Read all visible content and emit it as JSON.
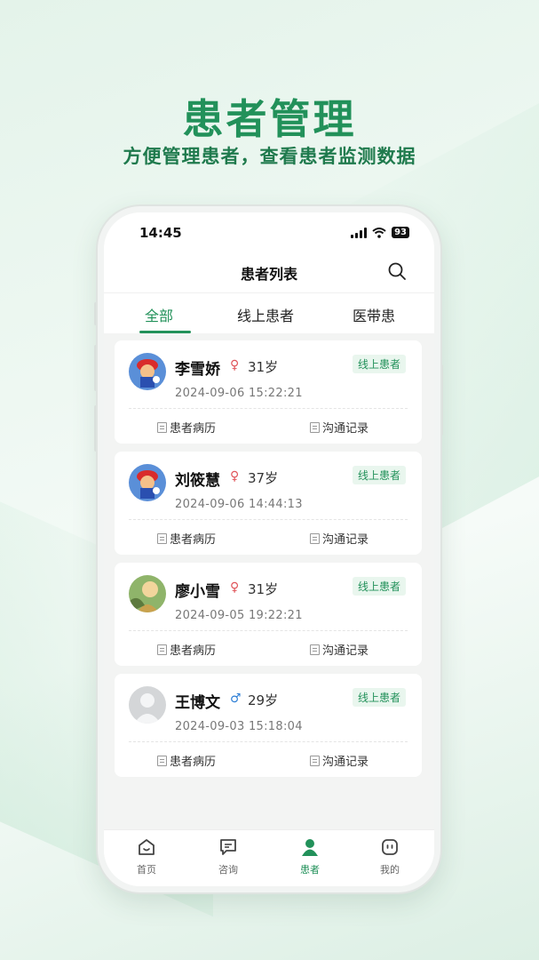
{
  "headline": "患者管理",
  "subline": "方便管理患者，查看患者监测数据",
  "status": {
    "time": "14:45",
    "battery": "93"
  },
  "navbar": {
    "title": "患者列表",
    "search_icon": "search-icon"
  },
  "tabs": [
    {
      "label": "全部",
      "active": true
    },
    {
      "label": "线上患者",
      "active": false
    },
    {
      "label": "医带患",
      "active": false
    }
  ],
  "patients": [
    {
      "name": "李雪娇",
      "gender": "female",
      "gender_symbol": "♀",
      "age": "31岁",
      "badge": "线上患者",
      "time": "2024-09-06 15:22:21",
      "record": "患者病历",
      "comm": "沟通记录",
      "avatar": "mario-avatar"
    },
    {
      "name": "刘筱慧",
      "gender": "female",
      "gender_symbol": "♀",
      "age": "37岁",
      "badge": "线上患者",
      "time": "2024-09-06 14:44:13",
      "record": "患者病历",
      "comm": "沟通记录",
      "avatar": "mario-avatar"
    },
    {
      "name": "廖小雪",
      "gender": "female",
      "gender_symbol": "♀",
      "age": "31岁",
      "badge": "线上患者",
      "time": "2024-09-05 19:22:21",
      "record": "患者病历",
      "comm": "沟通记录",
      "avatar": "photo-avatar"
    },
    {
      "name": "王博文",
      "gender": "male",
      "gender_symbol": "♂",
      "age": "29岁",
      "badge": "线上患者",
      "time": "2024-09-03 15:18:04",
      "record": "患者病历",
      "comm": "沟通记录",
      "avatar": "default-avatar"
    }
  ],
  "tabbar": [
    {
      "label": "首页",
      "icon": "home-icon",
      "active": false
    },
    {
      "label": "咨询",
      "icon": "chat-icon",
      "active": false
    },
    {
      "label": "患者",
      "icon": "patient-icon",
      "active": true
    },
    {
      "label": "我的",
      "icon": "profile-icon",
      "active": false
    }
  ],
  "colors": {
    "accent": "#22915a",
    "female": "#e0555a",
    "male": "#2f7fd6"
  }
}
